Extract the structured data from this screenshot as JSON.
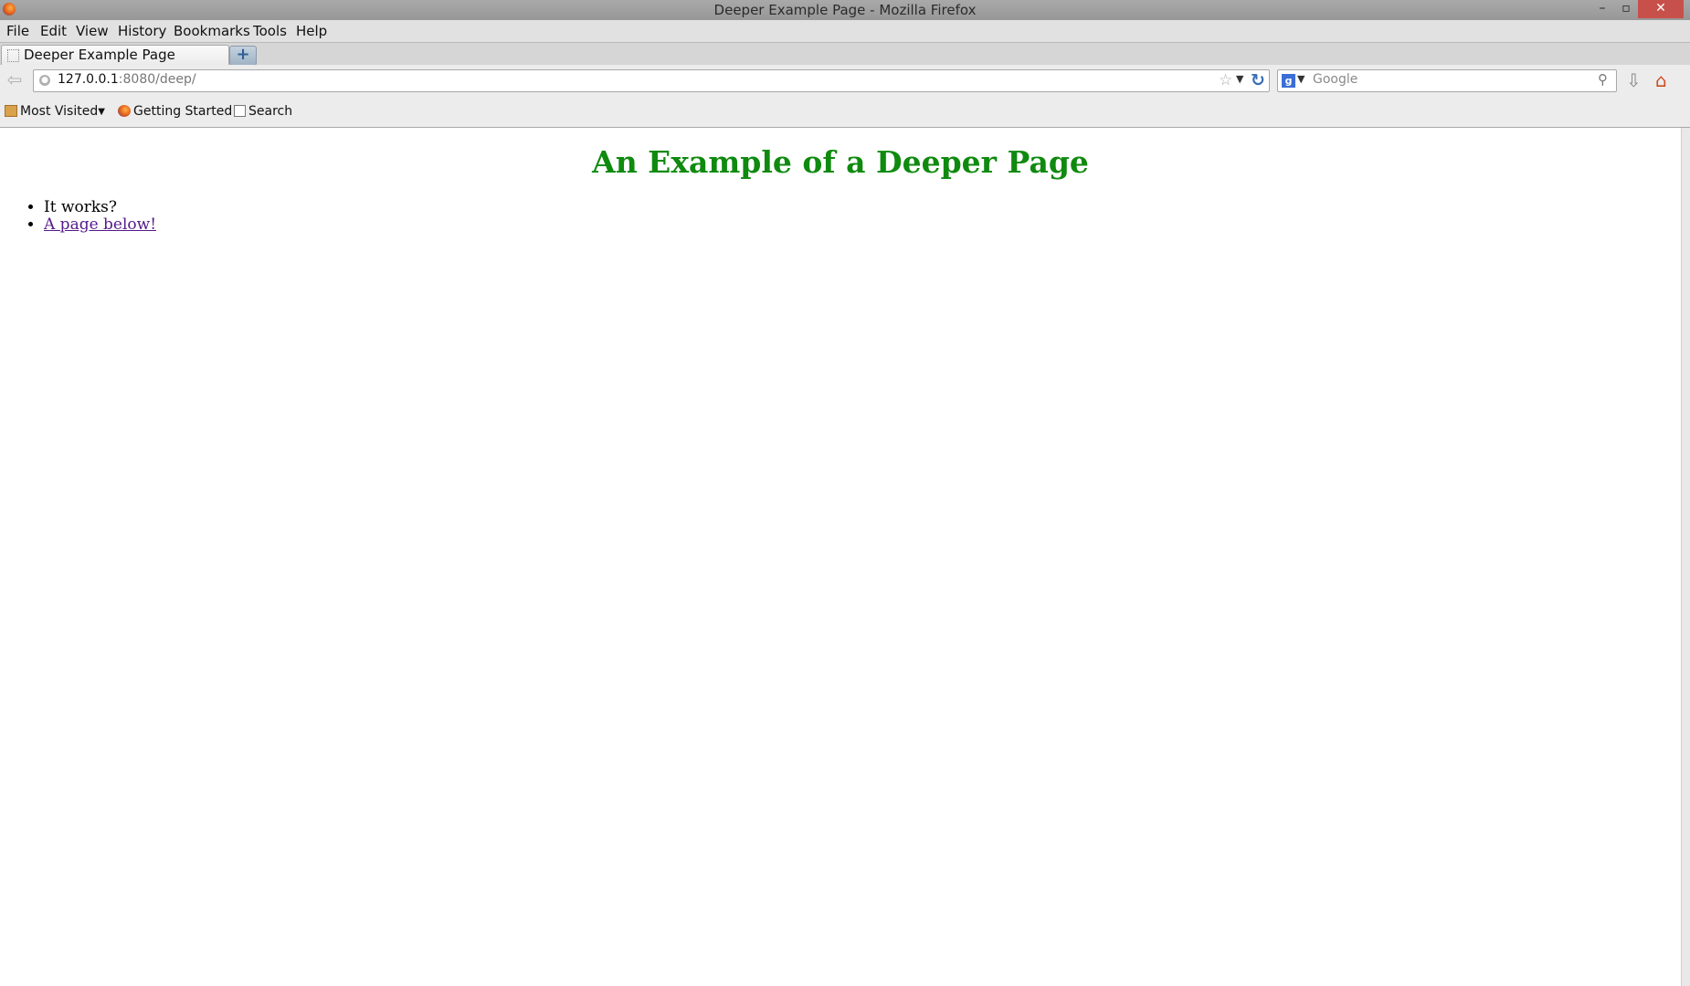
{
  "window": {
    "title": "Deeper Example Page - Mozilla Firefox",
    "minimize_glyph": "–",
    "maximize_glyph": "▫",
    "close_glyph": "✕"
  },
  "menu": {
    "items": [
      {
        "label": "File"
      },
      {
        "label": "Edit"
      },
      {
        "label": "View"
      },
      {
        "label": "History"
      },
      {
        "label": "Bookmarks"
      },
      {
        "label": "Tools"
      },
      {
        "label": "Help"
      }
    ]
  },
  "tabs": {
    "active_label": "Deeper Example Page",
    "new_tab_glyph": "+"
  },
  "navbar": {
    "url_host": "127.0.0.1",
    "url_rest": ":8080/deep/",
    "search_placeholder": "Google",
    "search_engine_glyph": "g"
  },
  "bookmarks": {
    "items": [
      {
        "label": "Most Visited",
        "icon": "folder-icon"
      },
      {
        "label": "Getting Started",
        "icon": "firefox-icon"
      },
      {
        "label": "Search",
        "icon": "search-bookmark-icon"
      }
    ]
  },
  "page": {
    "heading": "An Example of a Deeper Page",
    "list": [
      {
        "text": "It works?"
      },
      {
        "text": "A page below!"
      }
    ]
  },
  "colors": {
    "heading": "#0f8a0f",
    "visited_link": "#551a8b",
    "close_button": "#c7504b"
  }
}
